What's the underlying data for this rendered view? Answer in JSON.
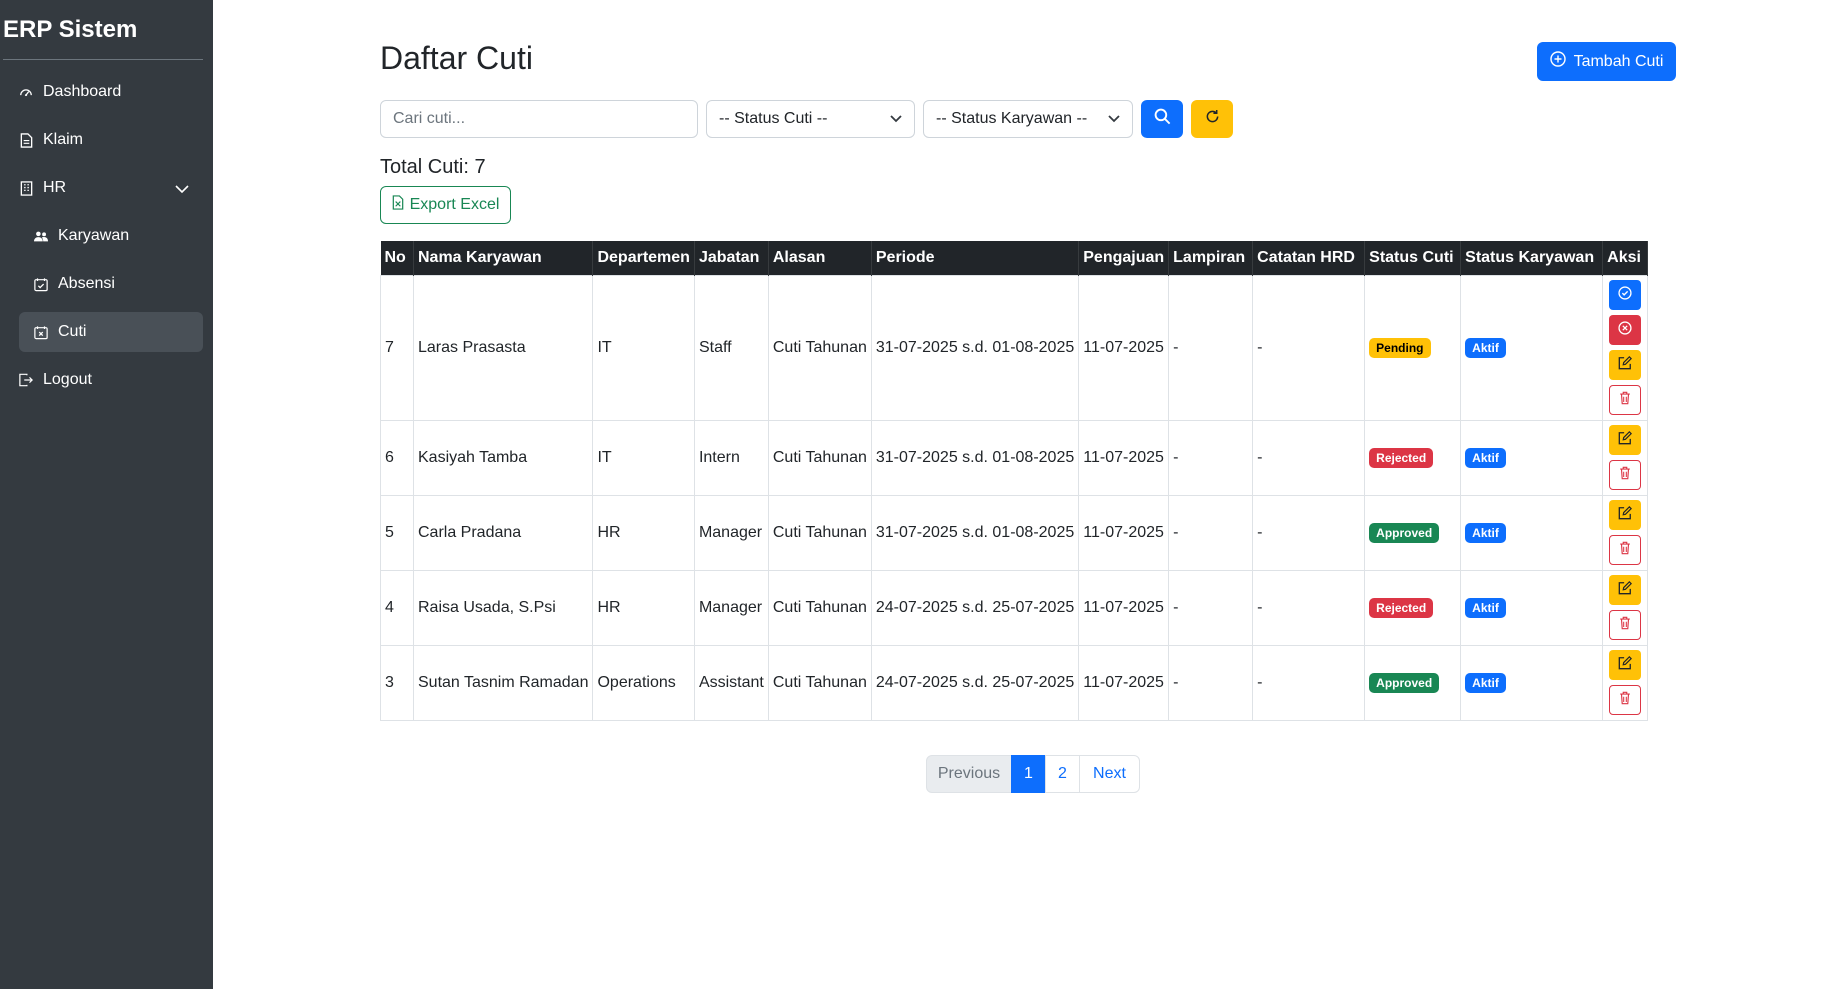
{
  "sidebar": {
    "brand": "ERP Sistem",
    "items": [
      {
        "label": "Dashboard",
        "icon": "speedometer-icon"
      },
      {
        "label": "Klaim",
        "icon": "document-icon"
      },
      {
        "label": "HR",
        "icon": "building-icon"
      },
      {
        "label": "Karyawan",
        "icon": "people-icon"
      },
      {
        "label": "Absensi",
        "icon": "calendar-check-icon"
      },
      {
        "label": "Cuti",
        "icon": "calendar-x-icon"
      },
      {
        "label": "Logout",
        "icon": "logout-icon"
      }
    ]
  },
  "header": {
    "title": "Daftar Cuti",
    "add_button": "Tambah Cuti"
  },
  "filters": {
    "search_placeholder": "Cari cuti...",
    "status_cuti": "-- Status Cuti --",
    "status_karyawan": "-- Status Karyawan --"
  },
  "summary": {
    "total": "Total Cuti: 7",
    "export_button": "Export Excel"
  },
  "table": {
    "columns": [
      "No",
      "Nama Karyawan",
      "Departemen",
      "Jabatan",
      "Alasan",
      "Periode",
      "Pengajuan",
      "Lampiran",
      "Catatan HRD",
      "Status Cuti",
      "Status Karyawan",
      "Aksi"
    ],
    "rows": [
      {
        "no": "7",
        "nama": "Laras Prasasta",
        "departemen": "IT",
        "jabatan": "Staff",
        "alasan": "Cuti Tahunan",
        "periode": "31-07-2025 s.d. 01-08-2025",
        "pengajuan": "11-07-2025",
        "lampiran": "-",
        "catatan": "-",
        "status_cuti": "Pending",
        "status_karyawan": "Aktif"
      },
      {
        "no": "6",
        "nama": "Kasiyah Tamba",
        "departemen": "IT",
        "jabatan": "Intern",
        "alasan": "Cuti Tahunan",
        "periode": "31-07-2025 s.d. 01-08-2025",
        "pengajuan": "11-07-2025",
        "lampiran": "-",
        "catatan": "-",
        "status_cuti": "Rejected",
        "status_karyawan": "Aktif"
      },
      {
        "no": "5",
        "nama": "Carla Pradana",
        "departemen": "HR",
        "jabatan": "Manager",
        "alasan": "Cuti Tahunan",
        "periode": "31-07-2025 s.d. 01-08-2025",
        "pengajuan": "11-07-2025",
        "lampiran": "-",
        "catatan": "-",
        "status_cuti": "Approved",
        "status_karyawan": "Aktif"
      },
      {
        "no": "4",
        "nama": "Raisa Usada, S.Psi",
        "departemen": "HR",
        "jabatan": "Manager",
        "alasan": "Cuti Tahunan",
        "periode": "24-07-2025 s.d. 25-07-2025",
        "pengajuan": "11-07-2025",
        "lampiran": "-",
        "catatan": "-",
        "status_cuti": "Rejected",
        "status_karyawan": "Aktif"
      },
      {
        "no": "3",
        "nama": "Sutan Tasnim Ramadan",
        "departemen": "Operations",
        "jabatan": "Assistant",
        "alasan": "Cuti Tahunan",
        "periode": "24-07-2025 s.d. 25-07-2025",
        "pengajuan": "11-07-2025",
        "lampiran": "-",
        "catatan": "-",
        "status_cuti": "Approved",
        "status_karyawan": "Aktif"
      }
    ]
  },
  "pagination": {
    "previous": "Previous",
    "pages": [
      "1",
      "2"
    ],
    "next": "Next"
  },
  "colors": {
    "sidebar_bg": "#343a40",
    "primary": "#0d6efd",
    "warning": "#ffc107",
    "danger": "#dc3545",
    "success": "#198754"
  }
}
